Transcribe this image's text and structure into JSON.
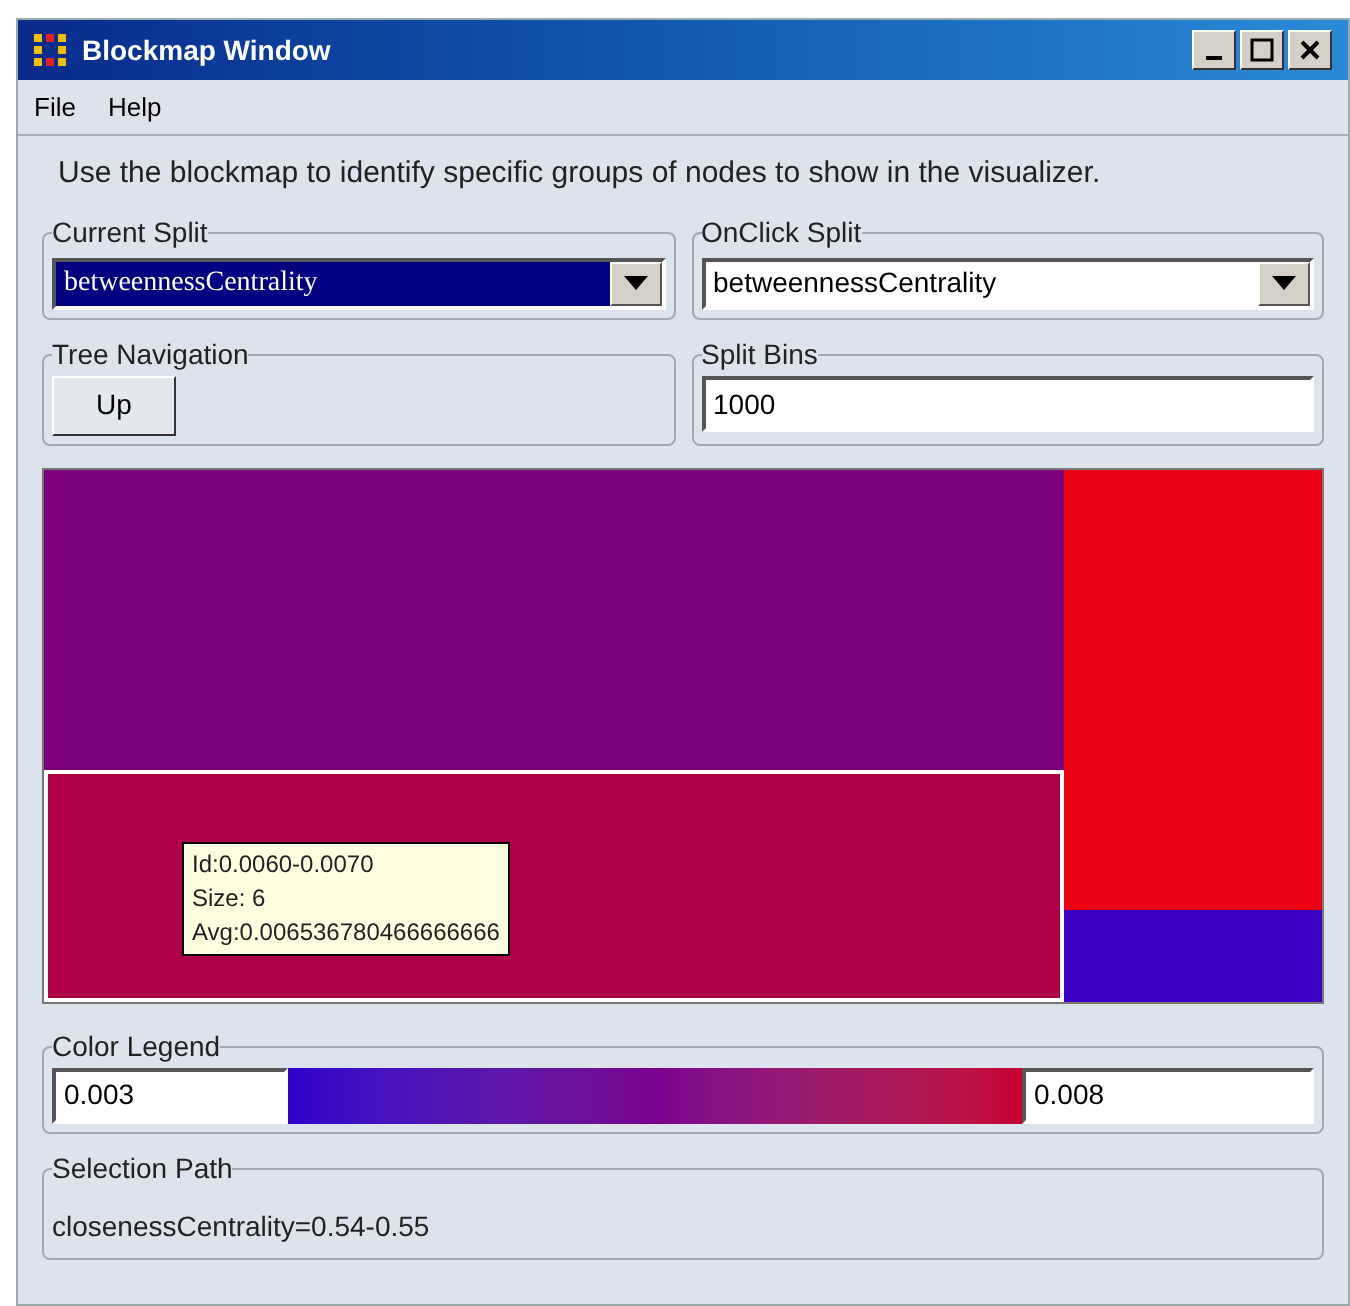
{
  "window": {
    "title": "Blockmap Window"
  },
  "menu": [
    "File",
    "Help"
  ],
  "instructions": "Use the blockmap to identify specific groups of nodes to show in the visualizer.",
  "current_split": {
    "label": "Current Split",
    "value": "betweennessCentrality",
    "focused": true
  },
  "onclick_split": {
    "label": "OnClick Split",
    "value": "betweennessCentrality",
    "focused": false
  },
  "tree_navigation": {
    "label": "Tree Navigation",
    "button": "Up"
  },
  "split_bins": {
    "label": "Split Bins",
    "value": "1000"
  },
  "blockmap": {
    "columns": [
      {
        "blocks": [
          {
            "color": "#7a007c",
            "selected": false
          },
          {
            "color": "#b00048",
            "selected": true
          }
        ]
      },
      {
        "blocks": [
          {
            "color": "#ec0014",
            "selected": false
          },
          {
            "color": "#3b00c2",
            "selected": false
          }
        ]
      }
    ],
    "tooltip": [
      "Id:0.0060-0.0070",
      "Size: 6",
      "Avg:0.006536780466666666"
    ]
  },
  "color_legend": {
    "label": "Color Legend",
    "min": "0.003",
    "max": "0.008"
  },
  "selection_path": {
    "label": "Selection Path",
    "value": "closenessCentrality=0.54-0.55"
  }
}
